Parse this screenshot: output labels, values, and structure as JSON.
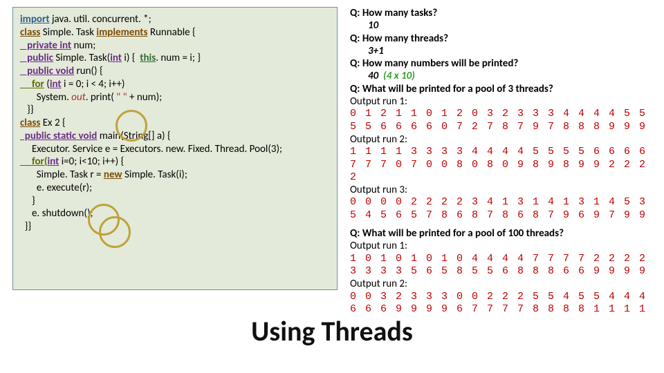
{
  "code": {
    "l01a": "import",
    "l01b": " java. util. concurrent. *;",
    "l02": "",
    "l03a": "class",
    "l03b": " Simple. Task ",
    "l03c": "implements",
    "l03d": " Runnable {",
    "l04a": "   private int",
    "l04b": " num;",
    "l05a": "   public",
    "l05b": " Simple. Task(",
    "l05c": "int",
    "l05d": " i) {  ",
    "l05e": "this",
    "l05f": ". num = i; }",
    "l06": "",
    "l07a": "   public void",
    "l07b": " run() {",
    "l08a": "     for",
    "l08b": " (",
    "l08c": "int",
    "l08d": " i = 0; i < 4; i++)",
    "l09a": "       System. ",
    "l09b": "out",
    "l09c": ". print( ",
    "l09d": "\" \"",
    "l09e": " + num);",
    "l10": "   }}",
    "l11": "",
    "l12a": "class",
    "l12b": " Ex 2 {",
    "l13a": "  public static void",
    "l13b": " main(String[] a) {",
    "l14": "     Executor. Service e = Executors. new. Fixed. Thread. Pool(3);",
    "l15a": "     for(",
    "l15b": "int",
    "l15c": " i=0; i<10; i++) {",
    "l16a": "       Simple. Task r = ",
    "l16b": "new",
    "l16c": " Simple. Task(i);",
    "l17": "       e. execute(r);",
    "l18": "     }",
    "l19": "     e. shutdown();",
    "l20": "  }}"
  },
  "qa": {
    "q1": "Q: How many tasks?",
    "a1": "10",
    "q2": "Q: How many threads?",
    "a2": "3+1",
    "q3": "Q: How many numbers will be printed?",
    "a3a": "40",
    "a3b": "(4 x 10)",
    "q4": "Q: What will be printed for a pool of 3 threads?",
    "out1_lbl": "Output run 1:",
    "out1": "0 1 2 1 1 0 1 2 0 3 2 3 3 3 4 4 4 4 5 5 5 5 6 6 6 6 0 7 2 7 8 7 9 7 8 8 8 9 9 9",
    "out2_lbl": "Output run 2:",
    "out2": "1 1 1 1 3 3 3 3 4 4 4 4 5 5 5 5 6 6 6 6 7 7 7 0 7 0 0 8 0 8 0 9 8 9 8 9 9 2 2 2 2",
    "out3_lbl": "Output run 3:",
    "out3": "0 0 0 0 2 2 2 2 3 4 1 3 1 4 1 3 1 4 5 3 5 4 5 6 5 7 8 6 8 7 8 6 8 7 9 6 9 7 9 9",
    "q5": "Q: What will be printed for a pool of 100 threads?",
    "out4_lbl": "Output run 1:",
    "out4": "1 0 1 0 1 0 1 0 4 4 4 4 7 7 7 7 2 2 2 2 3 3 3 3 5 6 5 8 5 5 6 8 8 8 6 6 9 9 9 9",
    "out5_lbl": "Output run 2:",
    "out5": "0 0 3 2 3 3 3 0 0 2 2 2 5 5 4 5 5 4 4 4 6 6 6 9 9 9 9 6 7 7 7 7 8 8 8 8 1 1 1 1"
  },
  "title": "Using Threads"
}
